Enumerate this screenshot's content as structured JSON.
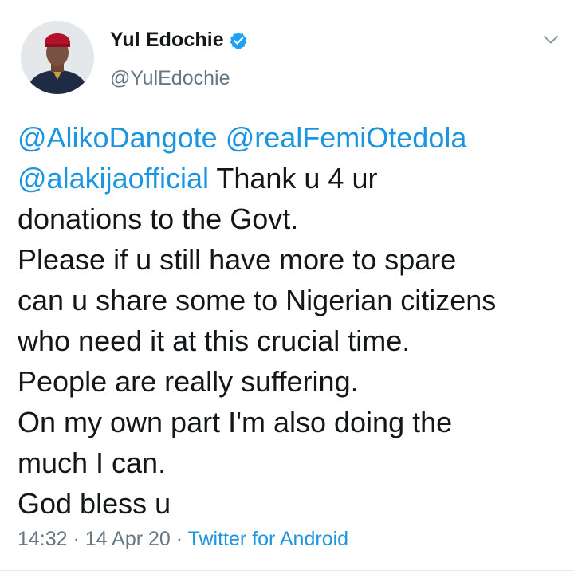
{
  "author": {
    "display_name": "Yul Edochie",
    "handle": "@YulEdochie",
    "verified": true,
    "avatar_icon": "profile-photo"
  },
  "menu_icon": "chevron-down-icon",
  "tweet": {
    "mentions": [
      "@AlikoDangote",
      "@realFemiOtedola",
      "@alakijaofficial"
    ],
    "lines": [
      " Thank u 4 ur",
      "donations to the Govt.",
      "Please if u still have more to spare",
      "can u share some to Nigerian citizens",
      "who need it at this crucial time.",
      "People are really suffering.",
      "On my own part I'm also doing the",
      "much I can.",
      "God bless u"
    ]
  },
  "meta": {
    "time": "14:32",
    "date": "14 Apr 20",
    "separator": " · ",
    "source": "Twitter for Android"
  },
  "colors": {
    "link": "#1b95e0",
    "verified_badge": "#1da1f2",
    "secondary_text": "#657786",
    "primary_text": "#14171a"
  }
}
